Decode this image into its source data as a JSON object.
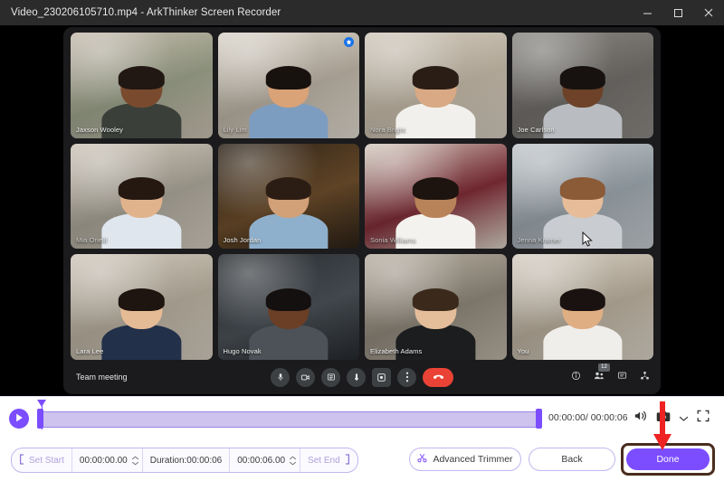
{
  "window": {
    "title": "Video_230206105710.mp4  -  ArkThinker Screen Recorder",
    "minimize_icon": "minimize-icon",
    "maximize_icon": "maximize-icon",
    "close_icon": "close-icon"
  },
  "meeting": {
    "title": "Team meeting",
    "participant_count": "12",
    "tiles": [
      {
        "name": "Jaxson Wooley",
        "pinned": false,
        "skin": "#7a4a2e",
        "hair": "#211713",
        "shirt": "#3a4039",
        "wall": "#cdc2b4",
        "accent": "#9aa089"
      },
      {
        "name": "Lily Lim",
        "pinned": true,
        "skin": "#d9a277",
        "hair": "#18120f",
        "shirt": "#7d9dc0",
        "wall": "#e3ddd2",
        "accent": "#b9b0a2"
      },
      {
        "name": "Nora Bright",
        "pinned": false,
        "skin": "#d8a984",
        "hair": "#2a1d16",
        "shirt": "#f2f0ec",
        "wall": "#d7cfc2",
        "accent": "#c3b8a7"
      },
      {
        "name": "Joe Carlson",
        "pinned": false,
        "skin": "#6d4228",
        "hair": "#171210",
        "shirt": "#b9bcc0",
        "wall": "#8d8a85",
        "accent": "#6f6c68"
      },
      {
        "name": "Mia Oneill",
        "pinned": false,
        "skin": "#e0b38c",
        "hair": "#241811",
        "shirt": "#dfe6ee",
        "wall": "#d5cdc0",
        "accent": "#a8a396"
      },
      {
        "name": "Josh Jordan",
        "pinned": false,
        "skin": "#d2a178",
        "hair": "#2c1d14",
        "shirt": "#8fb0cc",
        "wall": "#2a2016",
        "accent": "#6b4c2a"
      },
      {
        "name": "Sonia Williams",
        "pinned": false,
        "skin": "#b9835a",
        "hair": "#1d1410",
        "shirt": "#f4f2ee",
        "wall": "#ddd6c9",
        "accent": "#7d2b35"
      },
      {
        "name": "Jenna Kramer",
        "pinned": false,
        "skin": "#e6bd98",
        "hair": "#8b5a36",
        "shirt": "#c9ccd1",
        "wall": "#c8cdd2",
        "accent": "#9aa4ab"
      },
      {
        "name": "Lara Lee",
        "pinned": false,
        "skin": "#e5bb95",
        "hair": "#1e1410",
        "shirt": "#23304a",
        "wall": "#d6cec1",
        "accent": "#b6ad9d"
      },
      {
        "name": "Hugo Novak",
        "pinned": false,
        "skin": "#6a3f26",
        "hair": "#141010",
        "shirt": "#4d5258",
        "wall": "#262a2e",
        "accent": "#4a5056"
      },
      {
        "name": "Elizabeth Adams",
        "pinned": false,
        "skin": "#e4bd9a",
        "hair": "#3b2a1c",
        "shirt": "#1b1d1f",
        "wall": "#bfb6a8",
        "accent": "#8c8578"
      },
      {
        "name": "You",
        "pinned": false,
        "skin": "#dfae83",
        "hair": "#1a1210",
        "shirt": "#f0eeea",
        "wall": "#ddd6ca",
        "accent": "#b8ad9c"
      }
    ],
    "toolbar": {
      "mic_icon": "microphone-icon",
      "camera_icon": "camera-icon",
      "present_icon": "present-screen-icon",
      "raise_hand_icon": "raise-hand-icon",
      "record_icon": "record-icon",
      "more_icon": "more-options-icon",
      "end_call_icon": "end-call-icon",
      "info_icon": "meeting-info-icon",
      "people_icon": "participants-icon",
      "chat_icon": "chat-icon",
      "activities_icon": "activities-icon"
    }
  },
  "player": {
    "play_icon": "play-icon",
    "current_time": "00:00:00",
    "total_time": "00:00:06",
    "time_readout": "00:00:00/ 00:00:06",
    "volume_icon": "volume-icon",
    "snapshot_icon": "snapshot-camera-icon",
    "snapshot_dropdown_icon": "chevron-down-icon",
    "fullscreen_icon": "fullscreen-icon",
    "playhead_position_percent": 0,
    "trim_start_percent": 0,
    "trim_end_percent": 100
  },
  "trimmer": {
    "set_start_label": "Set Start",
    "set_start_icon": "bracket-left-icon",
    "start_value": "00:00:00.00",
    "duration_label": "Duration:00:00:06",
    "end_value": "00:00:06.00",
    "set_end_label": "Set End",
    "set_end_icon": "bracket-right-icon",
    "advanced_trimmer_label": "Advanced Trimmer",
    "advanced_trimmer_icon": "scissors-icon",
    "back_label": "Back",
    "done_label": "Done",
    "stepper_icon": "spinner-arrows-icon"
  },
  "annotation": {
    "arrow_color": "#ee2222",
    "highlight_color": "#4a2d1f"
  },
  "colors": {
    "accent": "#7c4dff",
    "titlebar_bg": "#2b2b2b",
    "panel_bg": "#ffffff",
    "end_call": "#ea4335",
    "pin_badge": "#1a73e8"
  }
}
